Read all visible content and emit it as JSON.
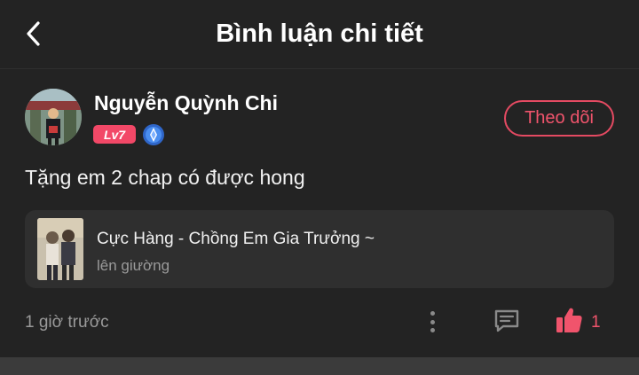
{
  "header": {
    "title": "Bình luận chi tiết",
    "back_icon": "chevron-left-icon"
  },
  "comment": {
    "username": "Nguyễn Quỳnh Chi",
    "level": "Lv7",
    "verify_icon": "verified-badge-icon",
    "follow_label": "Theo dõi",
    "text": "Tặng em 2 chap có được hong",
    "timestamp": "1 giờ trước",
    "like_count": "1"
  },
  "manga": {
    "title": "Cực Hàng - Chồng Em Gia Trưởng ~",
    "subtitle": "lên giường"
  },
  "actions": {
    "more_icon": "more-vertical-icon",
    "comment_icon": "comment-icon",
    "like_icon": "thumbs-up-icon"
  },
  "colors": {
    "accent": "#f0546c",
    "background": "#232323",
    "card": "#2f2f2f"
  }
}
